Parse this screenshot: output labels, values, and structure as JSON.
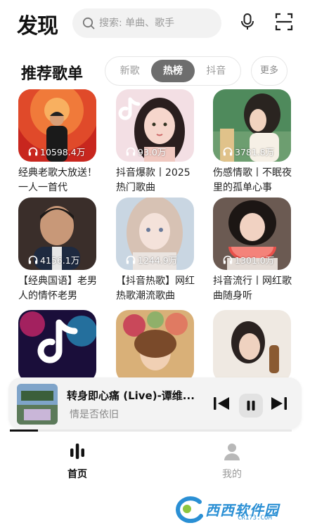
{
  "header": {
    "title": "发现",
    "search_placeholder": "搜索: 单曲、歌手",
    "mic_icon": "microphone-icon",
    "scan_icon": "scan-icon"
  },
  "recommend": {
    "title": "推荐歌单",
    "tabs": [
      {
        "label": "新歌",
        "active": false
      },
      {
        "label": "热榜",
        "active": true
      },
      {
        "label": "抖音",
        "active": false
      }
    ],
    "more_label": "更多"
  },
  "playlists": [
    {
      "plays": "10598.4万",
      "title": "经典老歌大放送！一人一首代"
    },
    {
      "plays": "93.0万",
      "title": "抖音爆款丨2025热门歌曲"
    },
    {
      "plays": "3781.8万",
      "title": "伤感情歌丨不眠夜里的孤单心事"
    },
    {
      "plays": "4156.1万",
      "title": "【经典国语】老男人的情怀老男"
    },
    {
      "plays": "1244.9万",
      "title": "【抖音热歌】网红热歌潮流歌曲"
    },
    {
      "plays": "1301.0万",
      "title": "抖音流行丨网红歌曲随身听"
    },
    {
      "plays": "",
      "title": ""
    },
    {
      "plays": "",
      "title": ""
    },
    {
      "plays": "",
      "title": ""
    }
  ],
  "player": {
    "song": "转身即心痛 (Live)-谭维...",
    "artist": "情是否依旧",
    "progress": 0.1
  },
  "nav": [
    {
      "label": "首页",
      "active": true,
      "icon": "home-bars-icon"
    },
    {
      "label": "我的",
      "active": false,
      "icon": "person-icon"
    }
  ],
  "watermark": {
    "text": "西西软件园",
    "url": "CR173.COM"
  },
  "colors": {
    "accent": "#111111",
    "tab_active_bg": "#6e6e6e",
    "muted": "#9a9a9a",
    "watermark": "#2a8fd4"
  }
}
